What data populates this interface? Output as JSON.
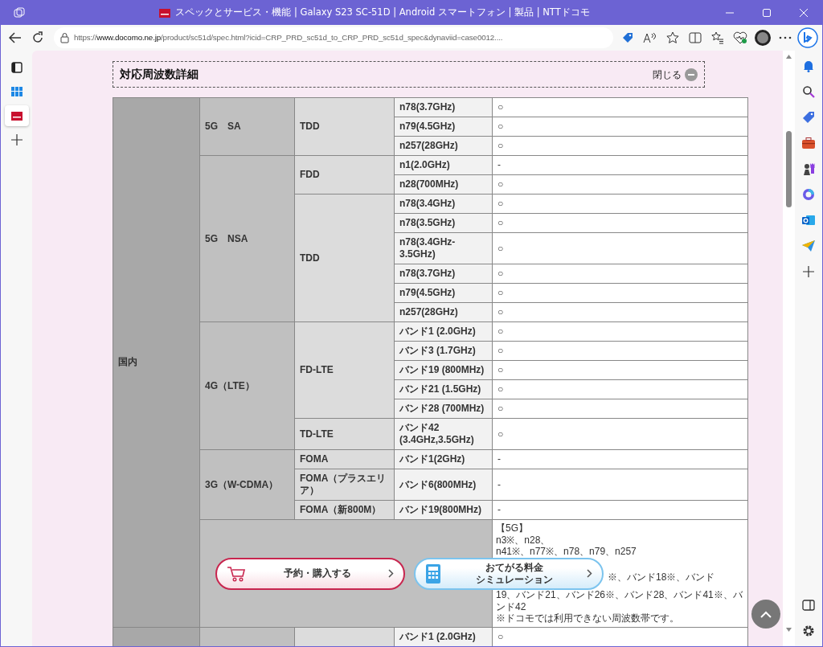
{
  "browser": {
    "title": "スペックとサービス・機能 | Galaxy S23 SC-51D | Android スマートフォン | 製品 | NTTドコモ",
    "url_host_prefix": "https://",
    "url_host": "www.docomo.ne.jp",
    "url_path": "/product/sc51d/spec.html?icid=CRP_PRD_sc51d_to_CRP_PRD_sc51d_spec&dynaviid=case0012....",
    "vertical_tabs": [
      {
        "selected": true
      }
    ]
  },
  "section": {
    "title": "対応周波数詳細",
    "toggle": "閉じる"
  },
  "table": {
    "groups": [
      {
        "region": "国内",
        "systems": [
          {
            "kind": "bands",
            "name": "5G　SA",
            "modes": [
              {
                "name": "TDD",
                "bands": [
                  {
                    "band": "n78(3.7GHz)",
                    "support": "○"
                  },
                  {
                    "band": "n79(4.5GHz)",
                    "support": "○"
                  },
                  {
                    "band": "n257(28GHz)",
                    "support": "○"
                  }
                ]
              }
            ]
          },
          {
            "kind": "bands",
            "name": "5G　NSA",
            "modes": [
              {
                "name": "FDD",
                "bands": [
                  {
                    "band": "n1(2.0GHz)",
                    "support": "-"
                  },
                  {
                    "band": "n28(700MHz)",
                    "support": "○"
                  }
                ]
              },
              {
                "name": "TDD",
                "bands": [
                  {
                    "band": "n78(3.4GHz)",
                    "support": "○"
                  },
                  {
                    "band": "n78(3.5GHz)",
                    "support": "○"
                  },
                  {
                    "band": "n78(3.4GHz-3.5GHz)",
                    "support": "○"
                  },
                  {
                    "band": "n78(3.7GHz)",
                    "support": "○"
                  },
                  {
                    "band": "n79(4.5GHz)",
                    "support": "○"
                  },
                  {
                    "band": "n257(28GHz)",
                    "support": "○"
                  }
                ]
              }
            ]
          },
          {
            "kind": "bands",
            "name": "4G（LTE）",
            "modes": [
              {
                "name": "FD-LTE",
                "bands": [
                  {
                    "band": "バンド1 (2.0GHz)",
                    "support": "○"
                  },
                  {
                    "band": "バンド3 (1.7GHz)",
                    "support": "○"
                  },
                  {
                    "band": "バンド19 (800MHz)",
                    "support": "○"
                  },
                  {
                    "band": "バンド21 (1.5GHz)",
                    "support": "○"
                  },
                  {
                    "band": "バンド28 (700MHz)",
                    "support": "○"
                  }
                ]
              },
              {
                "name": "TD-LTE",
                "bands": [
                  {
                    "band": "バンド42 (3.4GHz,3.5GHz)",
                    "support": "○"
                  }
                ]
              }
            ]
          },
          {
            "kind": "bands",
            "name": "3G（W-CDMA）",
            "modes": [
              {
                "name": "FOMA",
                "bands": [
                  {
                    "band": "バンド1(2GHz)",
                    "support": "-"
                  }
                ]
              },
              {
                "name": "FOMA（プラスエリア）",
                "bands": [
                  {
                    "band": "バンド6(800MHz)",
                    "support": "-"
                  }
                ]
              },
              {
                "name": "FOMA（新800M）",
                "bands": [
                  {
                    "band": "バンド19(800MHz)",
                    "support": "-"
                  }
                ]
              }
            ]
          },
          {
            "kind": "note",
            "lines": [
              {
                "text": "【5G】"
              },
              {
                "text": "n3※、n28、"
              },
              {
                "text": "n41※、n77※、n78、n79、n257"
              },
              {
                "text": "※、バンド18※、バンド",
                "indent": true,
                "gap_before": true
              },
              {
                "text": "19、バンド21、バンド26※、バンド28、バンド41※、バ"
              },
              {
                "text": "ンド42"
              },
              {
                "text": "※ドコモでは利用できない周波数帯です。"
              }
            ]
          }
        ]
      },
      {
        "systems": [
          {
            "kind": "bands",
            "modes": [
              {
                "bands": [
                  {
                    "band": "バンド1 (2.0GHz)",
                    "support": "○"
                  }
                ]
              }
            ]
          }
        ]
      }
    ]
  },
  "floating_buttons": [
    {
      "kind": "reserve",
      "lines": [
        "予約・購入する"
      ]
    },
    {
      "kind": "simulation",
      "lines": [
        "おてがる料金",
        "シミュレーション"
      ]
    }
  ]
}
